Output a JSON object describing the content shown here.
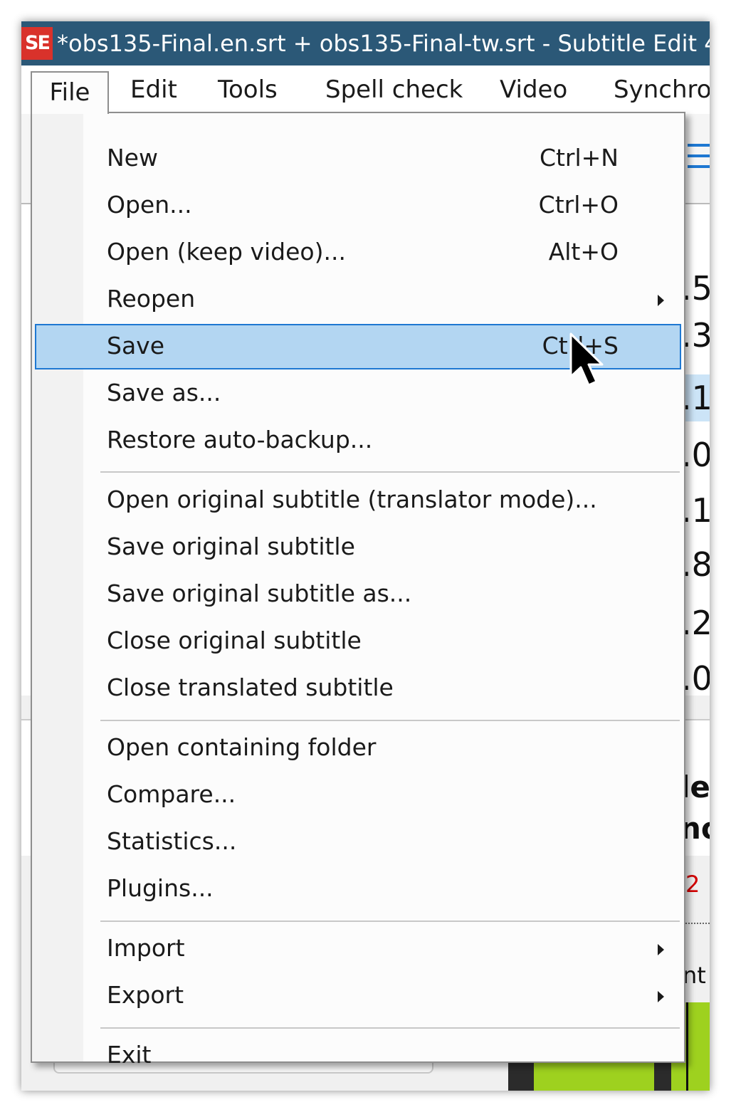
{
  "window": {
    "title": "*obs135-Final.en.srt + obs135-Final-tw.srt - Subtitle Edit 4",
    "app_icon_text": "SE"
  },
  "menubar": {
    "items": [
      "File",
      "Edit",
      "Tools",
      "Spell check",
      "Video",
      "Synchro"
    ]
  },
  "background_fragments": {
    "grid_cells": [
      "",
      ".5",
      ".3",
      ".1",
      ".0",
      ".1",
      ".8",
      ".2",
      ".0"
    ],
    "bold_text": [
      "le",
      "no"
    ],
    "red_digit": "2",
    "partial_label": "nt"
  },
  "file_menu": {
    "items": [
      {
        "label": "New",
        "shortcut": "Ctrl+N"
      },
      {
        "label": "Open...",
        "shortcut": "Ctrl+O"
      },
      {
        "label": "Open (keep video)...",
        "shortcut": "Alt+O"
      },
      {
        "label": "Reopen",
        "shortcut": "",
        "submenu": true
      },
      {
        "label": "Save",
        "shortcut": "Ctrl+S",
        "highlighted": true
      },
      {
        "label": "Save as...",
        "shortcut": ""
      },
      {
        "label": "Restore auto-backup...",
        "shortcut": ""
      },
      {
        "label": "Open original subtitle (translator mode)...",
        "shortcut": ""
      },
      {
        "label": "Save original subtitle",
        "shortcut": ""
      },
      {
        "label": "Save original subtitle as...",
        "shortcut": ""
      },
      {
        "label": "Close original subtitle",
        "shortcut": ""
      },
      {
        "label": "Close translated subtitle",
        "shortcut": ""
      },
      {
        "label": "Open containing folder",
        "shortcut": ""
      },
      {
        "label": "Compare...",
        "shortcut": ""
      },
      {
        "label": "Statistics...",
        "shortcut": ""
      },
      {
        "label": "Plugins...",
        "shortcut": ""
      },
      {
        "label": "Import",
        "shortcut": "",
        "submenu": true
      },
      {
        "label": "Export",
        "shortcut": "",
        "submenu": true
      },
      {
        "label": "Exit",
        "shortcut": ""
      }
    ]
  },
  "colors": {
    "titlebar": "#2b5877",
    "highlight_fill": "#b3d6f2",
    "highlight_border": "#1e78d2",
    "waveform": "#9ed11f"
  }
}
